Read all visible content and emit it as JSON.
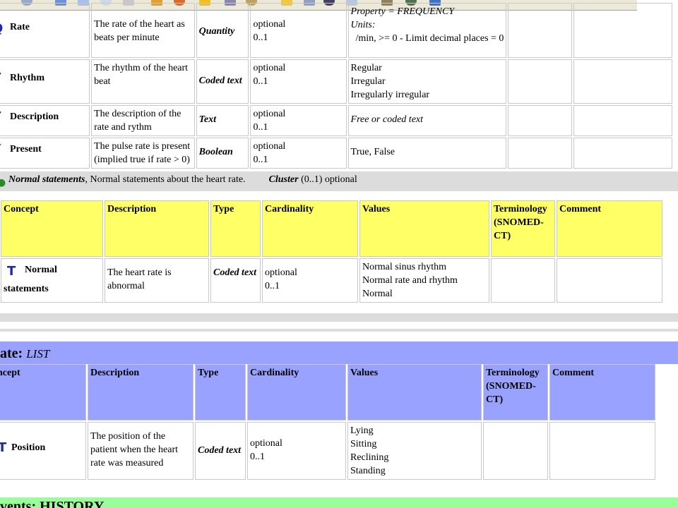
{
  "toolbar": {
    "icons": [
      "back-icon",
      "forward-icon",
      "page-icon",
      "copy-icon",
      "paste-icon",
      "globe-icon",
      "pencil-icon",
      "favorites-star-icon",
      "history-icon",
      "mail-icon",
      "folder-icon",
      "search-icon",
      "dot-icon",
      "page-view-icon",
      "mode-icon",
      "window-icon",
      "note-icon"
    ]
  },
  "top_table": {
    "rows": [
      {
        "icon": "Q",
        "concept": "Rate",
        "description": "The rate of the heart as beats per minute",
        "type": "Quantity",
        "cardinality": [
          "optional",
          "0..1"
        ],
        "values_lines": [
          "Property = FREQUENCY",
          "Units:",
          "  /min, >= 0 - Limit decimal places = 0"
        ]
      },
      {
        "icon": "T",
        "concept": "Rhythm",
        "description": "The rhythm of the heart beat",
        "type": "Coded text",
        "cardinality": [
          "optional",
          "0..1"
        ],
        "values_lines": [
          "Regular",
          "Irregular",
          "Irregularly irregular"
        ]
      },
      {
        "icon": "T",
        "concept": "Description",
        "description": "The description of the rate and rythm",
        "type": "Text",
        "cardinality": [
          "optional",
          "0..1"
        ],
        "values_lines": [
          "Free or coded text"
        ]
      },
      {
        "icon": "✗",
        "concept": "Present",
        "description": "The pulse rate is present (implied true if rate > 0)",
        "type": "Boolean",
        "cardinality": [
          "optional",
          "0..1"
        ],
        "values_lines": [
          "True, False"
        ]
      }
    ]
  },
  "cluster": {
    "name": "Normal statements",
    "description": ", Normal statements about the heart rate.",
    "kind": "Cluster",
    "cardinality": " (0..1) optional"
  },
  "cluster_table": {
    "headers": [
      "Concept",
      "Description",
      "Type",
      "Cardinality",
      "Values",
      "Terminology (SNOMED-CT)",
      "Comment"
    ],
    "row": {
      "icon": "T",
      "concept_line1": "Normal",
      "concept_line2": "statements",
      "description": "The heart rate is abnormal",
      "type": "Coded text",
      "cardinality": [
        "optional",
        "0..1"
      ],
      "values_lines": [
        "Normal sinus rhythm",
        "Normal rate and rhythm",
        "Normal"
      ]
    }
  },
  "rate_section": {
    "title": "ate: ",
    "type": "LIST"
  },
  "rate_table": {
    "headers": [
      "ncept",
      "Description",
      "Type",
      "Cardinality",
      "Values",
      "Terminology (SNOMED-CT)",
      "Comment"
    ],
    "row": {
      "icon": "T",
      "concept": "Position",
      "description": "The position of the patient when the heart rate was measured",
      "type": "Coded text",
      "cardinality": [
        "optional",
        "0..1"
      ],
      "values_lines": [
        "Lying",
        "Sitting",
        "Reclining",
        "Standing"
      ]
    }
  },
  "events_section": {
    "title": "vents: HISTORY"
  },
  "colors": {
    "yellow_header": "#ffff66",
    "blue_header": "#99a3ff",
    "cluster_bar": "#dcdcdc",
    "events_bar": "#99ff99",
    "icon_blue": "#1b2aa8",
    "icon_red": "#d03a00"
  }
}
